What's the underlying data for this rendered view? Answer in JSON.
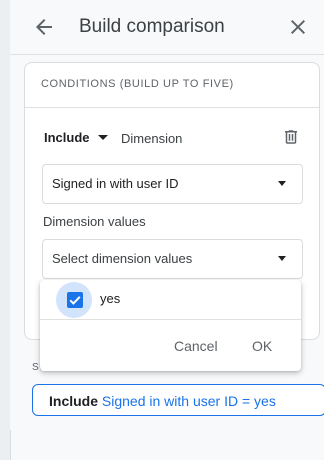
{
  "header": {
    "title": "Build comparison"
  },
  "conditions": {
    "section_title": "CONDITIONS (BUILD UP TO FIVE)",
    "include_label": "Include",
    "dimension_label": "Dimension",
    "dimension_select": "Signed in with user ID",
    "dimension_values_label": "Dimension values",
    "dimension_values_placeholder": "Select dimension values"
  },
  "dropdown": {
    "options": [
      {
        "label": "yes",
        "checked": true
      }
    ],
    "cancel_label": "Cancel",
    "ok_label": "OK"
  },
  "summary": {
    "label": "SU",
    "include": "Include",
    "condition": "Signed in with user ID = yes"
  },
  "icons": {
    "back": "arrow-back-icon",
    "close": "close-icon",
    "trash": "trash-icon",
    "check": "checkmark-icon"
  },
  "colors": {
    "accent": "#1a73e8",
    "halo": "#d2e3fc"
  }
}
